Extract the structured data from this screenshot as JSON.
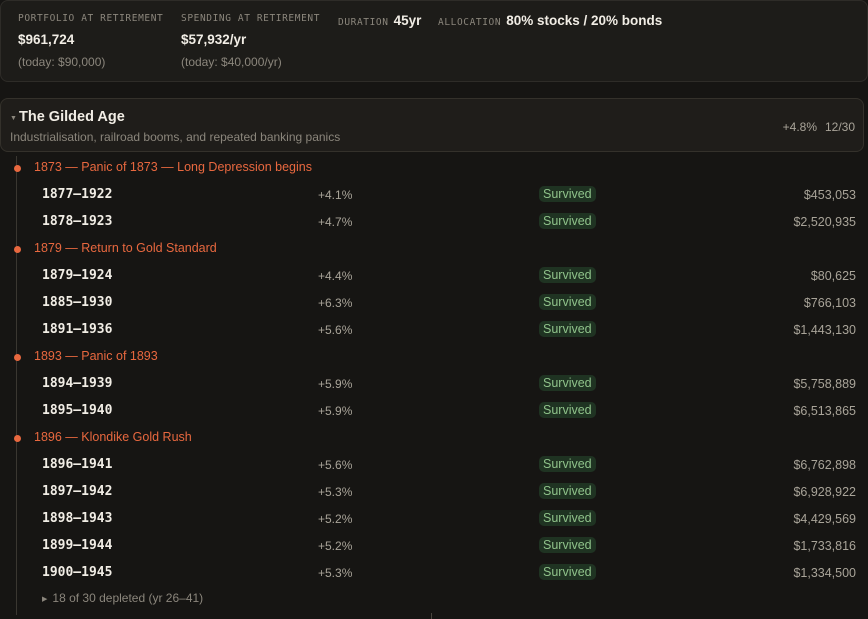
{
  "summary": {
    "portfolio": {
      "label": "PORTFOLIO AT RETIREMENT",
      "value": "$961,724",
      "sub": "(today: $90,000)"
    },
    "spending": {
      "label": "SPENDING AT RETIREMENT",
      "value": "$57,932/yr",
      "sub": "(today: $40,000/yr)"
    },
    "duration": {
      "label": "DURATION",
      "value": "45yr"
    },
    "allocation": {
      "label": "ALLOCATION",
      "value": "80% stocks / 20% bonds"
    }
  },
  "era": {
    "title": "The Gilded Age",
    "description": "Industrialisation, railroad booms, and repeated banking panics",
    "avg_return": "+4.8%",
    "count": "12/30"
  },
  "groups": [
    {
      "event": "1873 — Panic of 1873 — Long Depression begins",
      "rows": [
        {
          "period": "1877–1922",
          "return": "+4.1%",
          "status": "Survived",
          "value": "$453,053"
        },
        {
          "period": "1878–1923",
          "return": "+4.7%",
          "status": "Survived",
          "value": "$2,520,935"
        }
      ]
    },
    {
      "event": "1879 — Return to Gold Standard",
      "rows": [
        {
          "period": "1879–1924",
          "return": "+4.4%",
          "status": "Survived",
          "value": "$80,625"
        },
        {
          "period": "1885–1930",
          "return": "+6.3%",
          "status": "Survived",
          "value": "$766,103"
        },
        {
          "period": "1891–1936",
          "return": "+5.6%",
          "status": "Survived",
          "value": "$1,443,130"
        }
      ]
    },
    {
      "event": "1893 — Panic of 1893",
      "rows": [
        {
          "period": "1894–1939",
          "return": "+5.9%",
          "status": "Survived",
          "value": "$5,758,889"
        },
        {
          "period": "1895–1940",
          "return": "+5.9%",
          "status": "Survived",
          "value": "$6,513,865"
        }
      ]
    },
    {
      "event": "1896 — Klondike Gold Rush",
      "rows": [
        {
          "period": "1896–1941",
          "return": "+5.6%",
          "status": "Survived",
          "value": "$6,762,898"
        },
        {
          "period": "1897–1942",
          "return": "+5.3%",
          "status": "Survived",
          "value": "$6,928,922"
        },
        {
          "period": "1898–1943",
          "return": "+5.2%",
          "status": "Survived",
          "value": "$4,429,569"
        },
        {
          "period": "1899–1944",
          "return": "+5.2%",
          "status": "Survived",
          "value": "$1,733,816"
        },
        {
          "period": "1900–1945",
          "return": "+5.3%",
          "status": "Survived",
          "value": "$1,334,500"
        }
      ]
    }
  ],
  "depleted": {
    "text": "18 of 30 depleted (yr 26–41)"
  },
  "colors": {
    "accent": "#e8683f",
    "survived": "#8fc28a",
    "survived_bg": "#1f3322"
  }
}
